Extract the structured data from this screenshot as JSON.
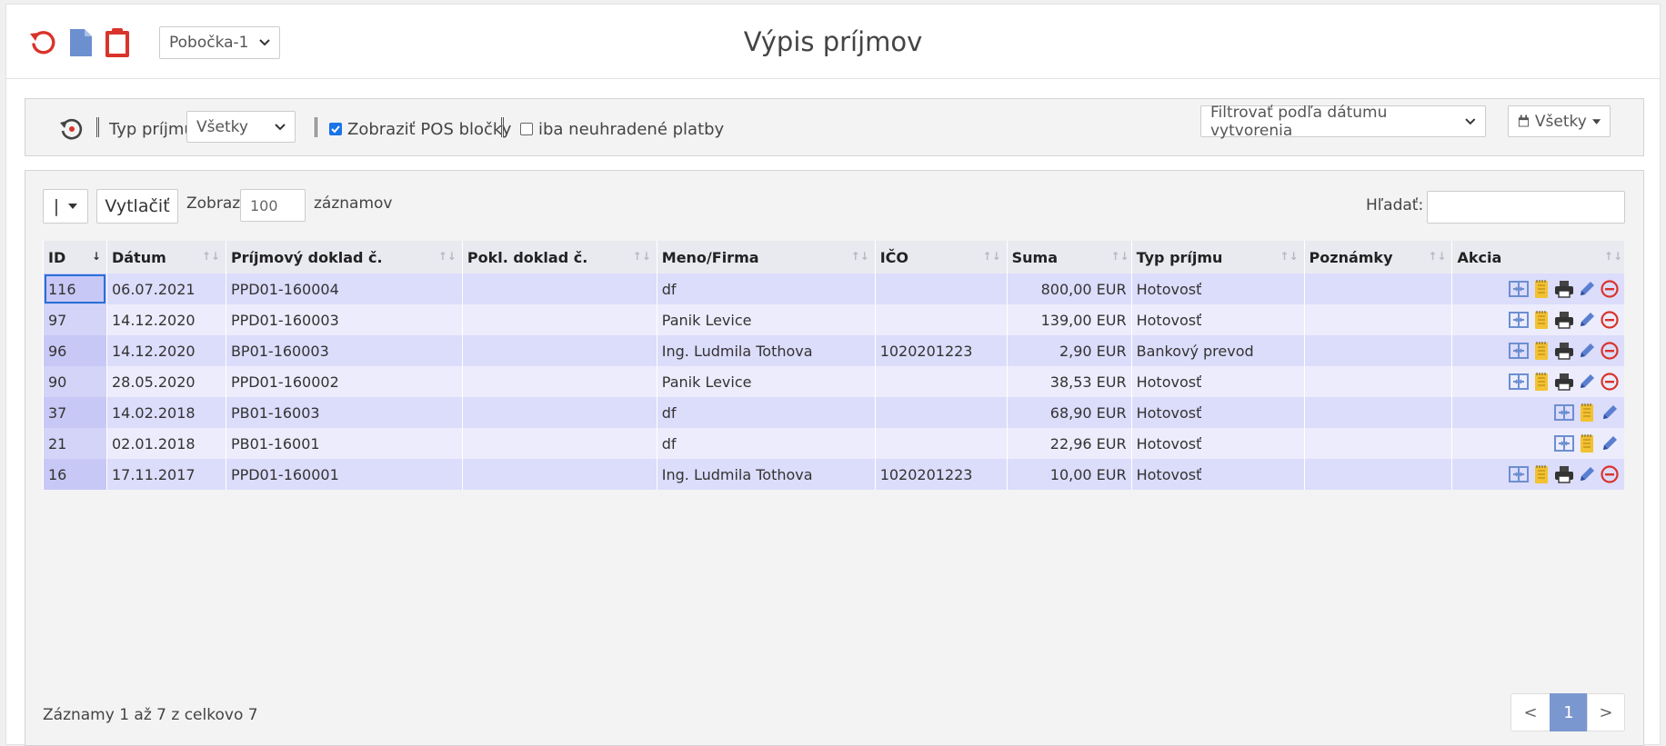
{
  "header": {
    "title": "Výpis príjmov",
    "branch_select_value": "Pobočka-1",
    "icons": [
      "refresh-icon",
      "document-icon",
      "clipboard-icon"
    ]
  },
  "filters": {
    "type_label": "Typ príjmu",
    "type_value": "Všetky",
    "pos_label": "Zobraziť POS bločky",
    "pos_checked": true,
    "unpaid_label": "iba neuhradené platby",
    "unpaid_checked": false,
    "date_filter_value": "Filtrovať podľa dátumu vytvorenia",
    "period_value": "Všetky"
  },
  "table_controls": {
    "column_toggle_label": "|",
    "print_label": "Vytlačiť",
    "show_label": "Zobraz",
    "page_size": "100",
    "records_label": "záznamov",
    "search_label": "Hľadať:",
    "search_value": ""
  },
  "columns": [
    "ID",
    "Dátum",
    "Príjmový doklad č.",
    "Pokl. doklad č.",
    "Meno/Firma",
    "IČO",
    "Suma",
    "Typ príjmu",
    "Poznámky",
    "Akcia"
  ],
  "rows": [
    {
      "id": "116",
      "date": "06.07.2021",
      "doc": "PPD01-160004",
      "pokl": "",
      "name": "df",
      "ico": "",
      "sum": "800,00 EUR",
      "type": "Hotovosť",
      "note": "",
      "full_actions": true
    },
    {
      "id": "97",
      "date": "14.12.2020",
      "doc": "PPD01-160003",
      "pokl": "",
      "name": "Panik Levice",
      "ico": "",
      "sum": "139,00 EUR",
      "type": "Hotovosť",
      "note": "",
      "full_actions": true
    },
    {
      "id": "96",
      "date": "14.12.2020",
      "doc": "BP01-160003",
      "pokl": "",
      "name": "Ing. Ludmila Tothova",
      "ico": "1020201223",
      "sum": "2,90 EUR",
      "type": "Bankový prevod",
      "note": "",
      "full_actions": true
    },
    {
      "id": "90",
      "date": "28.05.2020",
      "doc": "PPD01-160002",
      "pokl": "",
      "name": "Panik Levice",
      "ico": "",
      "sum": "38,53 EUR",
      "type": "Hotovosť",
      "note": "",
      "full_actions": true
    },
    {
      "id": "37",
      "date": "14.02.2018",
      "doc": "PB01-16003",
      "pokl": "",
      "name": "df",
      "ico": "",
      "sum": "68,90 EUR",
      "type": "Hotovosť",
      "note": "",
      "full_actions": false
    },
    {
      "id": "21",
      "date": "02.01.2018",
      "doc": "PB01-16001",
      "pokl": "",
      "name": "df",
      "ico": "",
      "sum": "22,96 EUR",
      "type": "Hotovosť",
      "note": "",
      "full_actions": false
    },
    {
      "id": "16",
      "date": "17.11.2017",
      "doc": "PPD01-160001",
      "pokl": "",
      "name": "Ing. Ludmila Tothova",
      "ico": "1020201223",
      "sum": "10,00 EUR",
      "type": "Hotovosť",
      "note": "",
      "full_actions": true
    }
  ],
  "footer": {
    "info": "Záznamy 1 až 7 z celkovo 7",
    "prev": "<",
    "page": "1",
    "next": ">"
  },
  "colors": {
    "accent": "#7a97cf",
    "danger": "#d9342b",
    "row_odd": "#dcdcfb",
    "row_even": "#ececfc"
  }
}
